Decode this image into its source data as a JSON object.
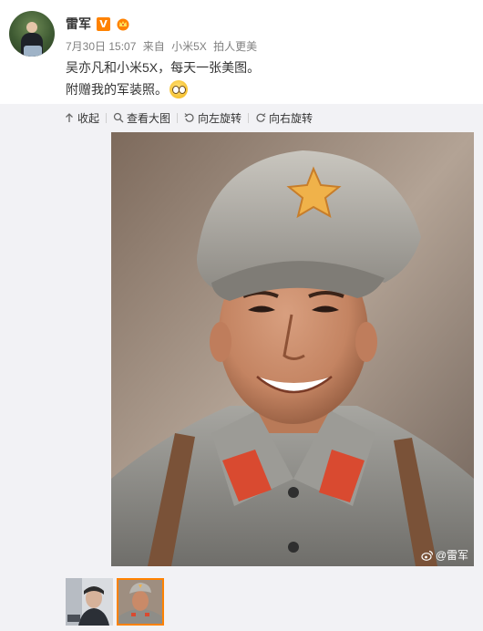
{
  "post": {
    "author": "雷军",
    "verified_badge": "V",
    "meta": {
      "date": "7月30日 15:07",
      "from_prefix": "来自",
      "device": "小米5X",
      "slogan": "拍人更美"
    },
    "text_lines": [
      "吴亦凡和小米5X，每天一张美图。",
      "附赠我的军装照。"
    ]
  },
  "media": {
    "toolbar": {
      "collapse": "收起",
      "view_large": "查看大图",
      "rotate_left": "向左旋转",
      "rotate_right": "向右旋转"
    },
    "watermark": "@雷军",
    "thumbnails": [
      {
        "name": "thumb-1",
        "active": false
      },
      {
        "name": "thumb-2",
        "active": true
      }
    ]
  },
  "colors": {
    "accent": "#ff8200",
    "text_primary": "#333333",
    "text_meta": "#808080",
    "panel_bg": "#f2f2f5"
  },
  "icons": [
    "crown-icon",
    "emoji-icon",
    "collapse-icon",
    "zoom-icon",
    "rotate-left-icon",
    "rotate-right-icon",
    "weibo-logo-icon"
  ]
}
